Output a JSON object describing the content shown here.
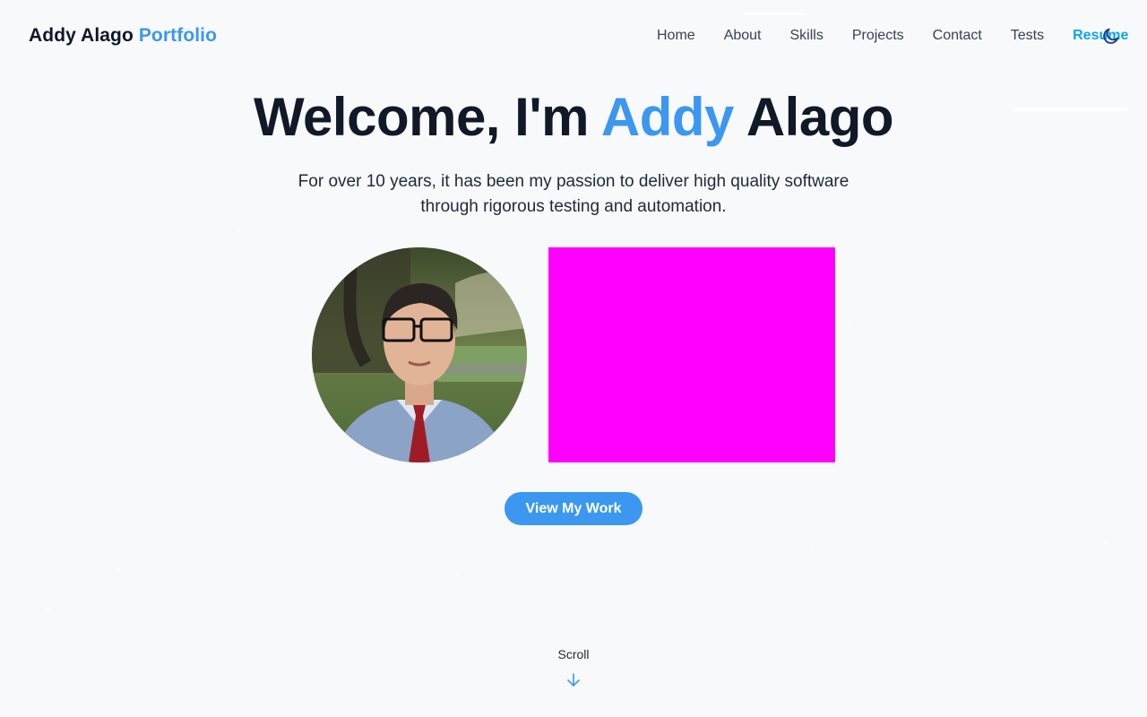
{
  "brand": {
    "name": "Addy Alago",
    "accent": "Portfolio"
  },
  "nav": {
    "items": [
      {
        "label": "Home"
      },
      {
        "label": "About"
      },
      {
        "label": "Skills"
      },
      {
        "label": "Projects"
      },
      {
        "label": "Contact"
      },
      {
        "label": "Tests"
      },
      {
        "label": "Resume"
      }
    ],
    "theme_toggle_icon": "moon-icon"
  },
  "hero": {
    "title_prefix": "Welcome, I'm",
    "title_first": "Addy",
    "title_last": "Alago",
    "subtitle": "For over 10 years, it has been my passion to deliver high quality software through rigorous testing and automation.",
    "cta_label": "View My Work"
  },
  "scroll": {
    "label": "Scroll",
    "icon": "arrow-down-icon"
  },
  "colors": {
    "accent": "#3b97f0",
    "resume": "#0ea5e9",
    "placeholder": "#ff00ff",
    "background": "#f7f9fb"
  }
}
